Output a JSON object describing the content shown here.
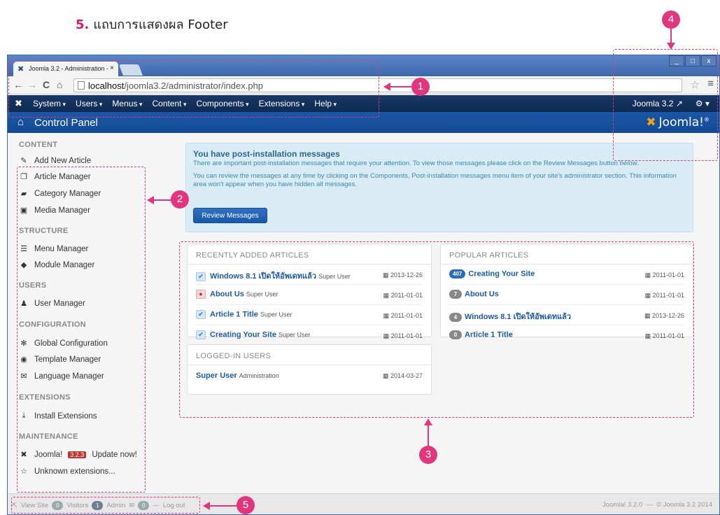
{
  "caption": {
    "number": "5.",
    "text": "แถบการแสดงผล Footer"
  },
  "browser": {
    "tab_title": "Joomla 3.2 - Administration -",
    "tab_close": "×",
    "url_host": "localhost",
    "url_path": "/joomla3.2/administrator/index.php",
    "win_buttons": [
      "_",
      "□",
      "x"
    ]
  },
  "admin_menu": {
    "items": [
      "System",
      "Users",
      "Menus",
      "Content",
      "Components",
      "Extensions",
      "Help"
    ],
    "version_link": "Joomla 3.2 ↗",
    "gear": "⚙ ▾"
  },
  "header": {
    "title": "Control Panel",
    "brand": "Joomla!",
    "reg": "®"
  },
  "sidebar": {
    "sections": [
      {
        "title": "CONTENT",
        "items": [
          {
            "icon": "pencil-icon",
            "glyph": "✎",
            "label": "Add New Article"
          },
          {
            "icon": "copy-icon",
            "glyph": "❐",
            "label": "Article Manager"
          },
          {
            "icon": "folder-icon",
            "glyph": "▰",
            "label": "Category Manager"
          },
          {
            "icon": "image-icon",
            "glyph": "▣",
            "label": "Media Manager"
          }
        ]
      },
      {
        "title": "STRUCTURE",
        "items": [
          {
            "icon": "list-icon",
            "glyph": "☰",
            "label": "Menu Manager"
          },
          {
            "icon": "cube-icon",
            "glyph": "◆",
            "label": "Module Manager"
          }
        ]
      },
      {
        "title": "USERS",
        "items": [
          {
            "icon": "users-icon",
            "glyph": "♟",
            "label": "User Manager"
          }
        ]
      },
      {
        "title": "CONFIGURATION",
        "items": [
          {
            "icon": "cog-icon",
            "glyph": "✻",
            "label": "Global Configuration"
          },
          {
            "icon": "eye-icon",
            "glyph": "◉",
            "label": "Template Manager"
          },
          {
            "icon": "comment-icon",
            "glyph": "✉",
            "label": "Language Manager"
          }
        ]
      },
      {
        "title": "EXTENSIONS",
        "items": [
          {
            "icon": "upload-icon",
            "glyph": "⤓",
            "label": "Install Extensions"
          }
        ]
      },
      {
        "title": "MAINTENANCE",
        "items": [
          {
            "icon": "joomla-icon",
            "glyph": "✖",
            "label": "Joomla!",
            "badge": "3.2.3",
            "suffix": "Update now!"
          },
          {
            "icon": "star-icon",
            "glyph": "☆",
            "label": "Unknown extensions..."
          }
        ]
      }
    ]
  },
  "message": {
    "heading": "You have post-installation messages",
    "p1": "There are important post-installation messages that require your attention. To view those messages please click on the Review Messages button below.",
    "p2": "You can review the messages at any time by clicking on the Components, Post-installation messages menu item of your site's administrator section. This information area won't appear when you have hidden all messages.",
    "button": "Review Messages"
  },
  "recent": {
    "title": "RECENTLY ADDED ARTICLES",
    "rows": [
      {
        "title": "Windows 8.1 เปิดให้อัพเดทแล้ว",
        "author": "Super User",
        "date": "2013-12-26",
        "state": "published"
      },
      {
        "title": "About Us",
        "author": "Super User",
        "date": "2011-01-01",
        "state": "unpublished"
      },
      {
        "title": "Article 1 Title",
        "author": "Super User",
        "date": "2011-01-01",
        "state": "published"
      },
      {
        "title": "Creating Your Site",
        "author": "Super User",
        "date": "2011-01-01",
        "state": "published"
      }
    ]
  },
  "popular": {
    "title": "POPULAR ARTICLES",
    "rows": [
      {
        "hits": "407",
        "title": "Creating Your Site",
        "date": "2011-01-01"
      },
      {
        "hits": "7",
        "title": "About Us",
        "date": "2011-01-01"
      },
      {
        "hits": "4",
        "title": "Windows 8.1 เปิดให้อัพเดทแล้ว",
        "date": "2013-12-26"
      },
      {
        "hits": "0",
        "title": "Article 1 Title",
        "date": "2011-01-01"
      }
    ]
  },
  "logged": {
    "title": "LOGGED-IN USERS",
    "rows": [
      {
        "name": "Super User",
        "role": "Administration",
        "date": "2014-03-27"
      }
    ]
  },
  "footer": {
    "view_site": "View Site",
    "visitors_count": "0",
    "visitors": "Visitors",
    "admin_count": "1",
    "admin": "Admin",
    "mail_count": "0",
    "logout": "Log out",
    "version": "Joomla! 3.2.0",
    "copyright": "© Joomla 3.2 2014"
  },
  "markers": [
    "1",
    "2",
    "3",
    "4",
    "5"
  ],
  "colors": {
    "accent": "#e1367d",
    "navy": "#0e2a54",
    "header_blue": "#1b57a6"
  }
}
